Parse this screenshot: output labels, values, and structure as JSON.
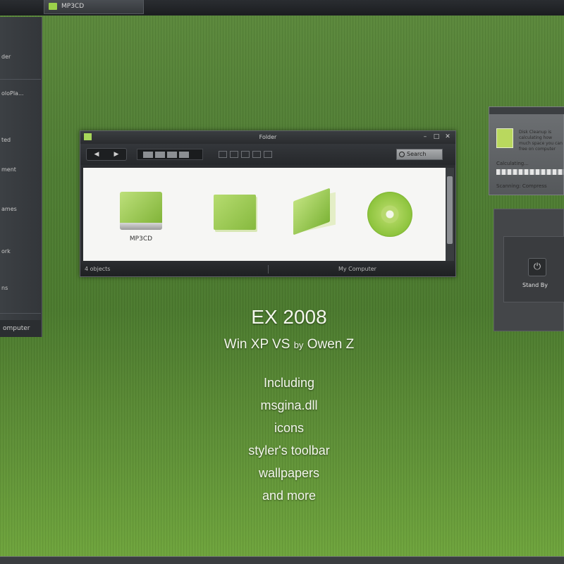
{
  "taskbar": {
    "button_label": "MP3CD"
  },
  "start_menu": {
    "items": [
      "der",
      "oloPla...",
      "ted",
      "ment",
      "ames",
      "ork",
      "ns"
    ],
    "footer": "omputer"
  },
  "explorer": {
    "title": "Folder",
    "search_placeholder": "Search",
    "drive_label": "MP3CD",
    "status_left": "4 objects",
    "status_right": "My Computer"
  },
  "gadget": {
    "text": "Disk Cleanup is calculating how much space you can free on computer",
    "calculating": "Calculating...",
    "footer": "Scanning: Compress"
  },
  "standby": {
    "label": "Stand By"
  },
  "promo": {
    "title": "EX 2008",
    "subtitle_a": "Win XP VS",
    "subtitle_by": "by",
    "subtitle_b": "Owen Z",
    "features": [
      "Including",
      "msgina.dll",
      "icons",
      "styler's toolbar",
      "wallpapers",
      "and more"
    ]
  }
}
